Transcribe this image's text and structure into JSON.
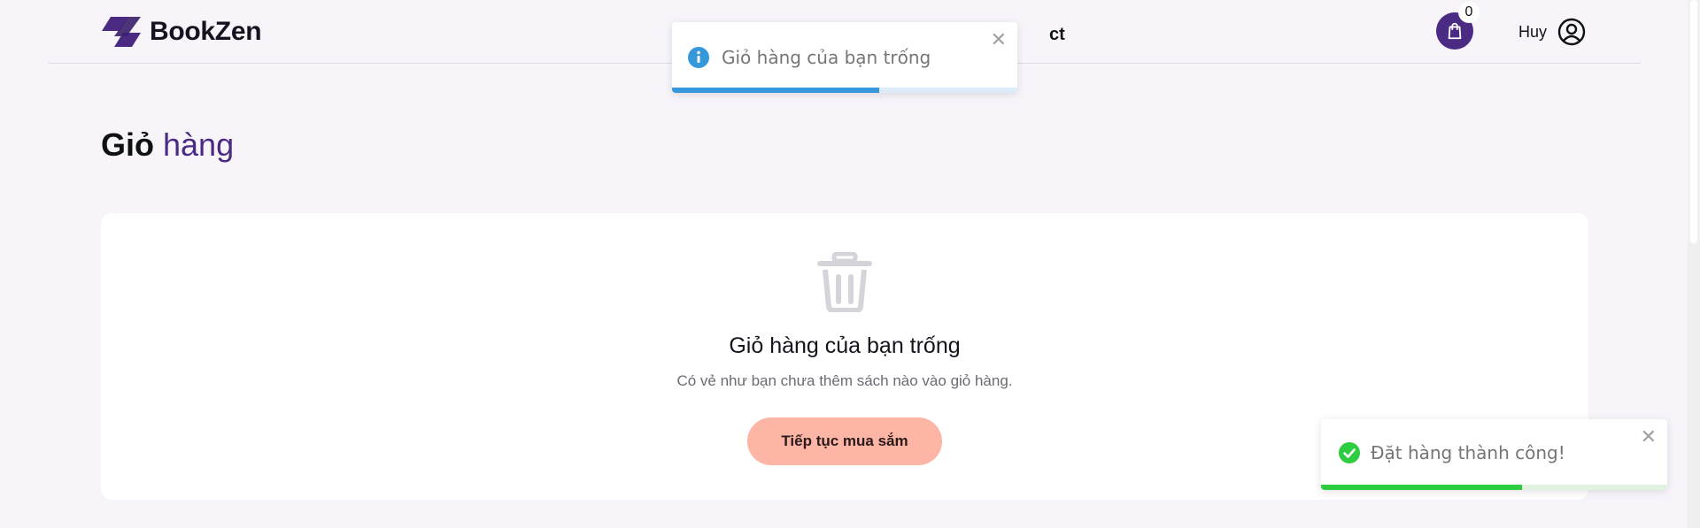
{
  "brand": {
    "name": "BookZen",
    "color": "#4a2a82"
  },
  "nav": {
    "contact_label": "ct"
  },
  "cart": {
    "count": "0"
  },
  "user": {
    "name": "Huy"
  },
  "page": {
    "title_bold": "Giỏ",
    "title_light": "hàng"
  },
  "empty_cart": {
    "title": "Giỏ hàng của bạn trống",
    "description": "Có vẻ như bạn chưa thêm sách nào vào giỏ hàng.",
    "button_label": "Tiếp tục mua sắm",
    "button_color": "#fdb5a6",
    "icon": "trash-icon"
  },
  "toasts": [
    {
      "type": "info",
      "message": "Giỏ hàng của bạn trống",
      "icon": "info-icon",
      "color": "#3498db",
      "progress": 0.6
    },
    {
      "type": "success",
      "message": "Đặt hàng thành công!",
      "icon": "check-circle-icon",
      "color": "#2ecc40",
      "progress": 0.58
    }
  ]
}
